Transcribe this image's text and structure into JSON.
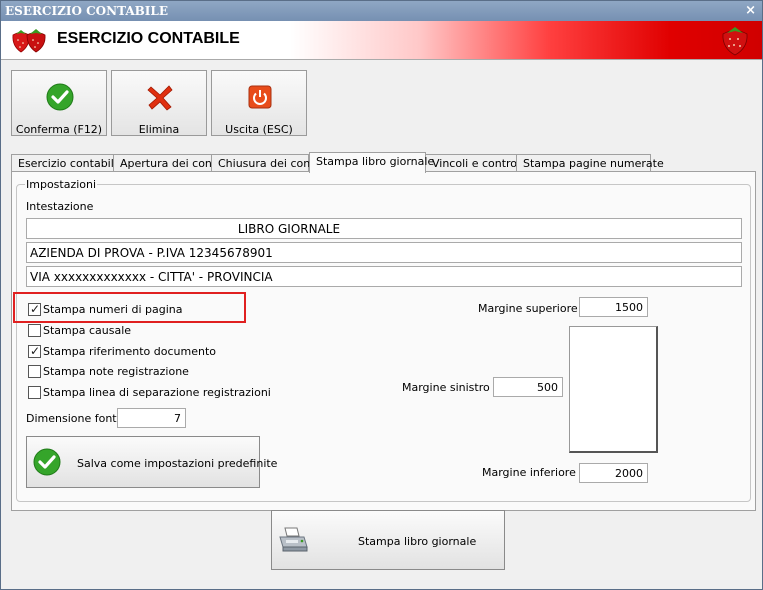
{
  "window": {
    "title": "ESERCIZIO CONTABILE",
    "close_glyph": "×"
  },
  "banner": {
    "title": "ESERCIZIO CONTABILE",
    "icon": "strawberry-icon"
  },
  "toolbar": {
    "confirm_label": "Conferma (F12)",
    "delete_label": "Elimina",
    "exit_label": "Uscita (ESC)"
  },
  "tabs": [
    {
      "label": "Esercizio contabile"
    },
    {
      "label": "Apertura dei conti"
    },
    {
      "label": "Chiusura dei conti"
    },
    {
      "label": "Stampa libro giornale",
      "active": true
    },
    {
      "label": "Vincoli e controlli"
    },
    {
      "label": "Stampa pagine numerate"
    }
  ],
  "settings": {
    "group_label": "Impostazioni",
    "header_label": "Intestazione",
    "header_lines": [
      "LIBRO GIORNALE",
      "AZIENDA DI PROVA - P.IVA 12345678901",
      "VIA xxxxxxxxxxxxx - CITTA' - PROVINCIA"
    ],
    "checkboxes": [
      {
        "label": "Stampa numeri di pagina",
        "checked": true
      },
      {
        "label": "Stampa causale",
        "checked": false
      },
      {
        "label": "Stampa riferimento documento",
        "checked": true
      },
      {
        "label": "Stampa note registrazione",
        "checked": false
      },
      {
        "label": "Stampa linea di separazione registrazioni",
        "checked": false
      }
    ],
    "font_size_label": "Dimensione font :",
    "font_size_value": "7",
    "save_defaults_label": "Salva come impostazioni predefinite",
    "margin_top_label": "Margine superiore :",
    "margin_top_value": "1500",
    "margin_left_label": "Margine sinistro :",
    "margin_left_value": "500",
    "margin_bottom_label": "Margine inferiore :",
    "margin_bottom_value": "2000"
  },
  "print_button_label": "Stampa libro giornale",
  "colors": {
    "accent_red": "#e00000",
    "highlight": "#e02020",
    "check_green": "#2e9e24"
  }
}
